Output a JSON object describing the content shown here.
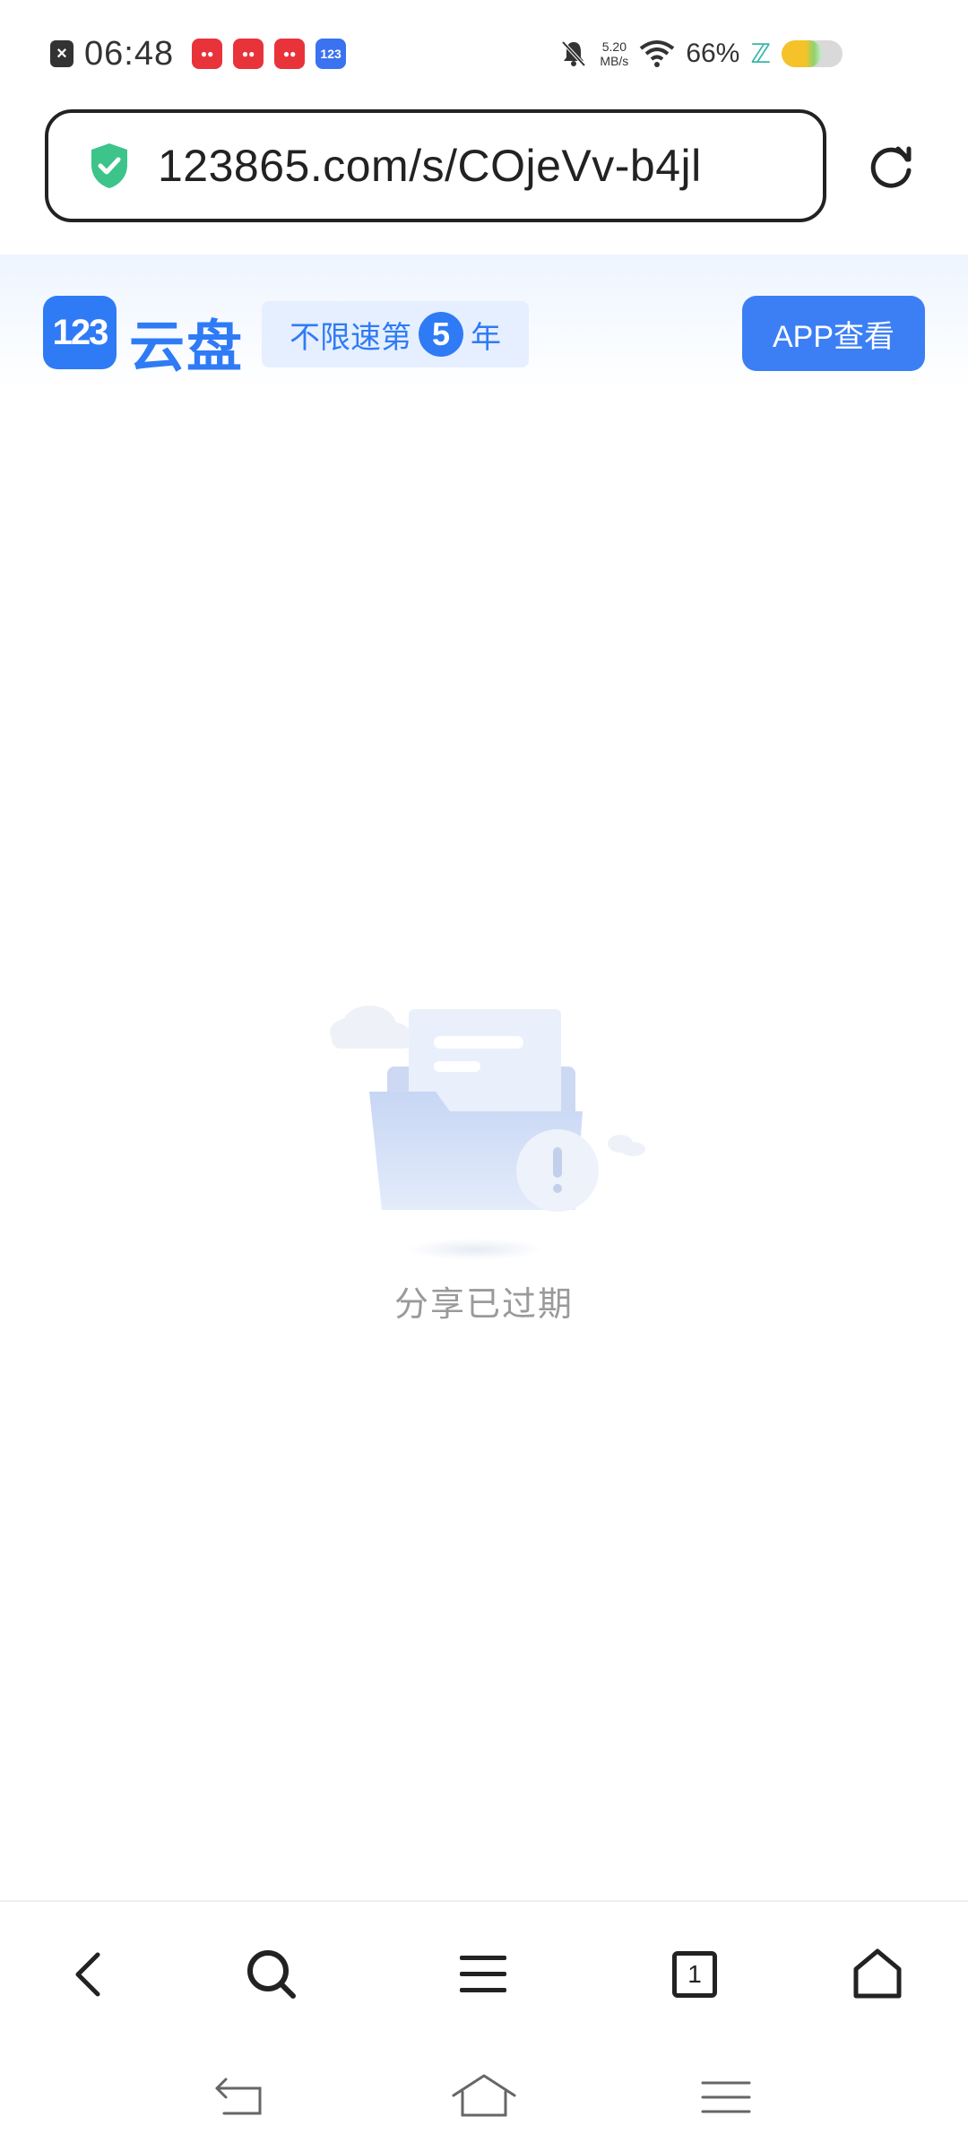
{
  "status_bar": {
    "time": "06:48",
    "network_speed_value": "5.20",
    "network_speed_unit": "MB/s",
    "battery_percent": "66%",
    "battery_level": 0.66,
    "notification_icons": [
      "app-notification-icon",
      "app-notification-icon",
      "app-notification-icon",
      "123pan-notification-icon"
    ]
  },
  "url_bar": {
    "url": "123865.com/s/COjeVv-b4jl"
  },
  "site_header": {
    "logo_mark": "123",
    "logo_text": "云盘",
    "promo_prefix": "不限速第",
    "promo_number": "5",
    "promo_suffix": "年",
    "app_button_label": "APP查看"
  },
  "empty_state": {
    "message": "分享已过期"
  },
  "bottom_toolbar": {
    "tab_count": "1"
  },
  "colors": {
    "brand": "#2f7bf6",
    "shield": "#3cc48a"
  }
}
